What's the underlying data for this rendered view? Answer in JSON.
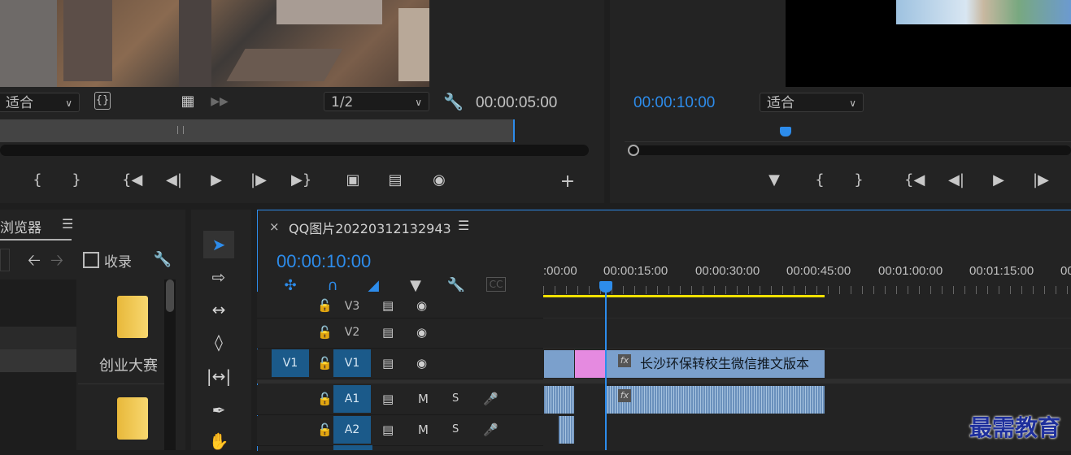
{
  "source_monitor": {
    "fit_label": "适合",
    "resolution": "1/2",
    "duration": "00:00:05:00"
  },
  "program_monitor": {
    "timecode": "00:00:10:00",
    "fit_label": "适合"
  },
  "project_panel": {
    "tab_label": "浏览器",
    "collect_label": "收录",
    "folders": [
      "创业大赛",
      ""
    ]
  },
  "timeline": {
    "sequence_name": "QQ图片20220312132943",
    "timecode": "00:00:10:00",
    "ruler_labels": [
      ":00:00",
      "00:00:15:00",
      "00:00:30:00",
      "00:00:45:00",
      "00:01:00:00",
      "00:01:15:00",
      "00"
    ],
    "tracks": [
      {
        "name": "V3",
        "type": "video"
      },
      {
        "name": "V2",
        "type": "video"
      },
      {
        "name": "V1",
        "type": "video",
        "source": "V1"
      },
      {
        "name": "A1",
        "type": "audio",
        "mute": "M",
        "solo": "S"
      },
      {
        "name": "A2",
        "type": "audio",
        "mute": "M",
        "solo": "S"
      }
    ],
    "clip_title": "长沙环保转校生微信推文版本",
    "fx_label": "fx"
  },
  "watermark": "最需教育",
  "colors": {
    "accent": "#2d8ceb",
    "clip_video": "#7ba0cc",
    "clip_pink": "#e58ae0",
    "work_area": "#f0e000"
  }
}
